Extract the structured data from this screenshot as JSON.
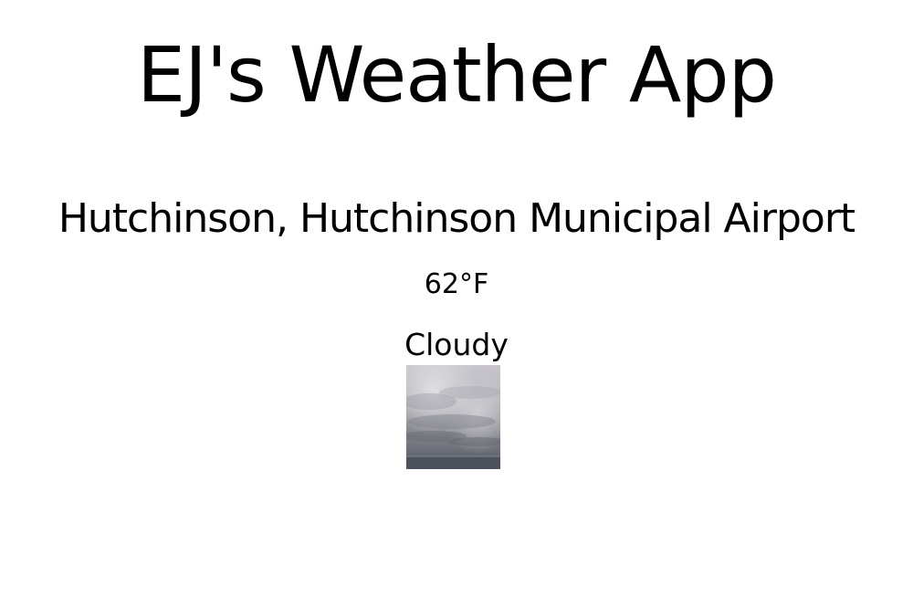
{
  "app": {
    "title": "EJ's Weather App"
  },
  "weather": {
    "location": "Hutchinson, Hutchinson Municipal Airport",
    "temperature": "62°F",
    "condition": "Cloudy",
    "image_icon": "cloudy-sky-photo"
  },
  "colors": {
    "background": "#ffffff",
    "text": "#000000",
    "cloud_light": "#d9d8dd",
    "cloud_dark": "#55585f"
  }
}
